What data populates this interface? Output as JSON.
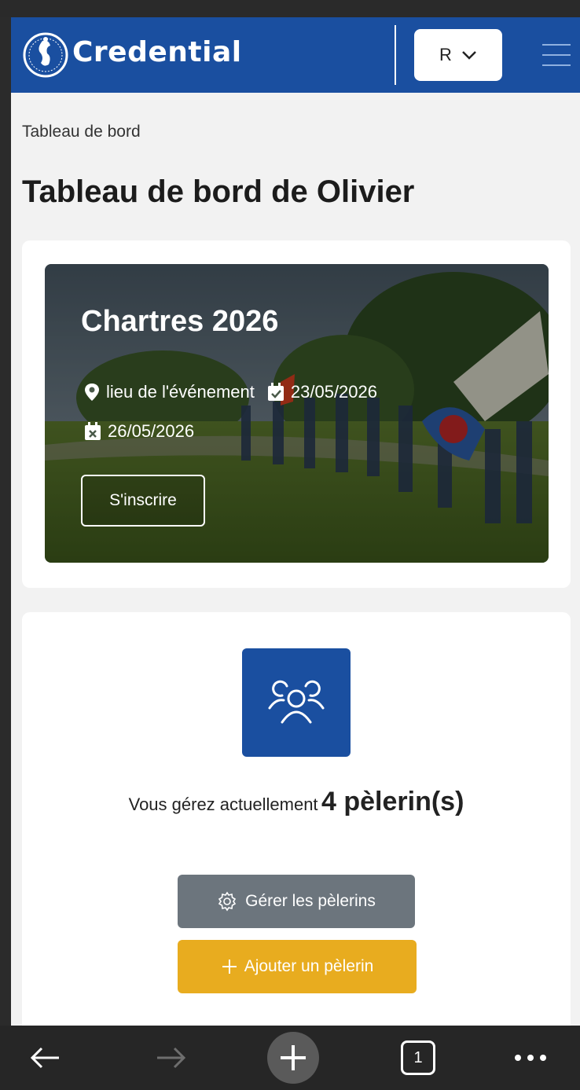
{
  "header": {
    "brand": "Credential",
    "language": "R"
  },
  "breadcrumb": "Tableau de bord",
  "page_title": "Tableau de bord de Olivier",
  "event": {
    "title": "Chartres 2026",
    "location": "lieu de l'événement",
    "start_date": "23/05/2026",
    "end_date": "26/05/2026",
    "register_label": "S'inscrire"
  },
  "pilgrims": {
    "prefix": "Vous gérez actuellement",
    "count_text": "4 pèlerin(s)",
    "manage_label": "Gérer les pèlerins",
    "add_label": "Ajouter un pèlerin"
  },
  "browser_nav": {
    "tab_count": "1"
  },
  "colors": {
    "primary": "#1a4fa0",
    "secondary": "#6c757d",
    "warning": "#e8ac1f"
  }
}
